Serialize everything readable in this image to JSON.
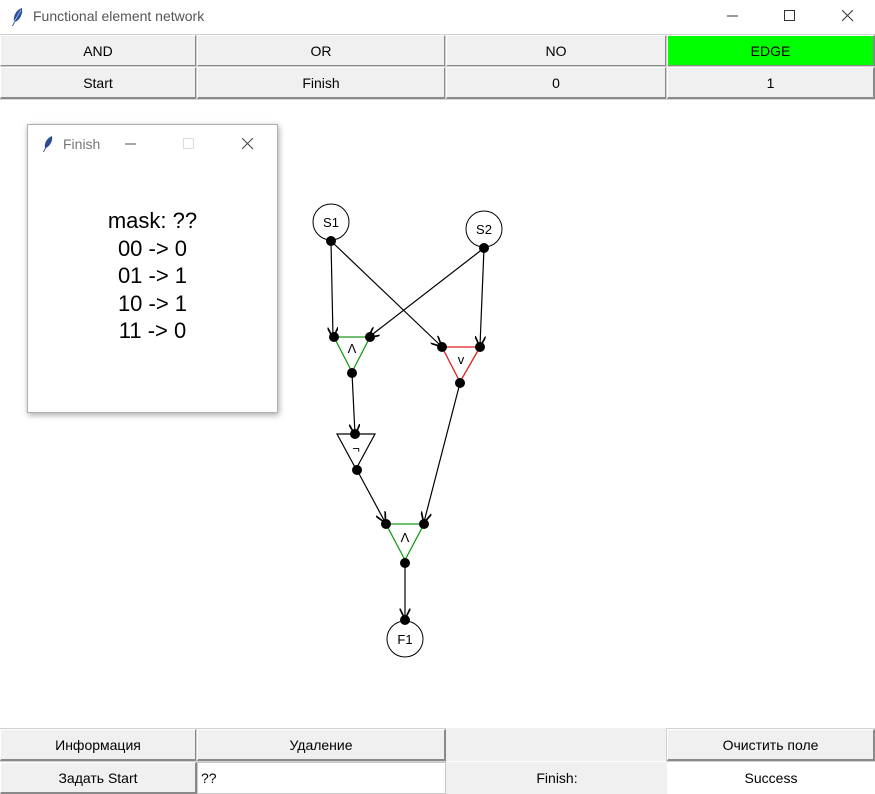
{
  "window": {
    "title": "Functional element network"
  },
  "toolbar": {
    "row1": [
      "AND",
      "OR",
      "NO",
      "EDGE"
    ],
    "row2": [
      "Start",
      "Finish",
      "0",
      "1"
    ],
    "active": "EDGE",
    "active_color": "#00ff00"
  },
  "graph": {
    "nodes": [
      "S1",
      "S2",
      "Λ",
      "v",
      "¬",
      "Λ",
      "F1"
    ],
    "and_color": "#1a9a1a",
    "or_color": "#e02020"
  },
  "popup": {
    "title": "Finish",
    "lines": [
      "mask: ??",
      "00 -> 0",
      "01 -> 1",
      "10 -> 1",
      "11 -> 0"
    ]
  },
  "bottom": {
    "info_button": "Информация",
    "delete_button": "Удаление",
    "clear_button": "Очистить поле",
    "set_start_button": "Задать Start",
    "start_input_value": "??",
    "finish_label": "Finish:",
    "result_value": "Success"
  }
}
